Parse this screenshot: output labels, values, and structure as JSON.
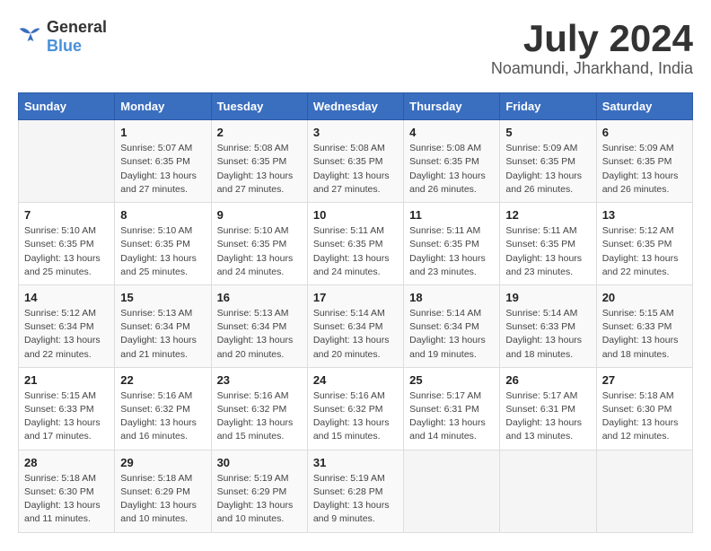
{
  "logo": {
    "text_general": "General",
    "text_blue": "Blue"
  },
  "title": {
    "month_year": "July 2024",
    "location": "Noamundi, Jharkhand, India"
  },
  "calendar": {
    "headers": [
      "Sunday",
      "Monday",
      "Tuesday",
      "Wednesday",
      "Thursday",
      "Friday",
      "Saturday"
    ],
    "weeks": [
      [
        {
          "day": "",
          "info": ""
        },
        {
          "day": "1",
          "info": "Sunrise: 5:07 AM\nSunset: 6:35 PM\nDaylight: 13 hours\nand 27 minutes."
        },
        {
          "day": "2",
          "info": "Sunrise: 5:08 AM\nSunset: 6:35 PM\nDaylight: 13 hours\nand 27 minutes."
        },
        {
          "day": "3",
          "info": "Sunrise: 5:08 AM\nSunset: 6:35 PM\nDaylight: 13 hours\nand 27 minutes."
        },
        {
          "day": "4",
          "info": "Sunrise: 5:08 AM\nSunset: 6:35 PM\nDaylight: 13 hours\nand 26 minutes."
        },
        {
          "day": "5",
          "info": "Sunrise: 5:09 AM\nSunset: 6:35 PM\nDaylight: 13 hours\nand 26 minutes."
        },
        {
          "day": "6",
          "info": "Sunrise: 5:09 AM\nSunset: 6:35 PM\nDaylight: 13 hours\nand 26 minutes."
        }
      ],
      [
        {
          "day": "7",
          "info": "Sunrise: 5:10 AM\nSunset: 6:35 PM\nDaylight: 13 hours\nand 25 minutes."
        },
        {
          "day": "8",
          "info": "Sunrise: 5:10 AM\nSunset: 6:35 PM\nDaylight: 13 hours\nand 25 minutes."
        },
        {
          "day": "9",
          "info": "Sunrise: 5:10 AM\nSunset: 6:35 PM\nDaylight: 13 hours\nand 24 minutes."
        },
        {
          "day": "10",
          "info": "Sunrise: 5:11 AM\nSunset: 6:35 PM\nDaylight: 13 hours\nand 24 minutes."
        },
        {
          "day": "11",
          "info": "Sunrise: 5:11 AM\nSunset: 6:35 PM\nDaylight: 13 hours\nand 23 minutes."
        },
        {
          "day": "12",
          "info": "Sunrise: 5:11 AM\nSunset: 6:35 PM\nDaylight: 13 hours\nand 23 minutes."
        },
        {
          "day": "13",
          "info": "Sunrise: 5:12 AM\nSunset: 6:35 PM\nDaylight: 13 hours\nand 22 minutes."
        }
      ],
      [
        {
          "day": "14",
          "info": "Sunrise: 5:12 AM\nSunset: 6:34 PM\nDaylight: 13 hours\nand 22 minutes."
        },
        {
          "day": "15",
          "info": "Sunrise: 5:13 AM\nSunset: 6:34 PM\nDaylight: 13 hours\nand 21 minutes."
        },
        {
          "day": "16",
          "info": "Sunrise: 5:13 AM\nSunset: 6:34 PM\nDaylight: 13 hours\nand 20 minutes."
        },
        {
          "day": "17",
          "info": "Sunrise: 5:14 AM\nSunset: 6:34 PM\nDaylight: 13 hours\nand 20 minutes."
        },
        {
          "day": "18",
          "info": "Sunrise: 5:14 AM\nSunset: 6:34 PM\nDaylight: 13 hours\nand 19 minutes."
        },
        {
          "day": "19",
          "info": "Sunrise: 5:14 AM\nSunset: 6:33 PM\nDaylight: 13 hours\nand 18 minutes."
        },
        {
          "day": "20",
          "info": "Sunrise: 5:15 AM\nSunset: 6:33 PM\nDaylight: 13 hours\nand 18 minutes."
        }
      ],
      [
        {
          "day": "21",
          "info": "Sunrise: 5:15 AM\nSunset: 6:33 PM\nDaylight: 13 hours\nand 17 minutes."
        },
        {
          "day": "22",
          "info": "Sunrise: 5:16 AM\nSunset: 6:32 PM\nDaylight: 13 hours\nand 16 minutes."
        },
        {
          "day": "23",
          "info": "Sunrise: 5:16 AM\nSunset: 6:32 PM\nDaylight: 13 hours\nand 15 minutes."
        },
        {
          "day": "24",
          "info": "Sunrise: 5:16 AM\nSunset: 6:32 PM\nDaylight: 13 hours\nand 15 minutes."
        },
        {
          "day": "25",
          "info": "Sunrise: 5:17 AM\nSunset: 6:31 PM\nDaylight: 13 hours\nand 14 minutes."
        },
        {
          "day": "26",
          "info": "Sunrise: 5:17 AM\nSunset: 6:31 PM\nDaylight: 13 hours\nand 13 minutes."
        },
        {
          "day": "27",
          "info": "Sunrise: 5:18 AM\nSunset: 6:30 PM\nDaylight: 13 hours\nand 12 minutes."
        }
      ],
      [
        {
          "day": "28",
          "info": "Sunrise: 5:18 AM\nSunset: 6:30 PM\nDaylight: 13 hours\nand 11 minutes."
        },
        {
          "day": "29",
          "info": "Sunrise: 5:18 AM\nSunset: 6:29 PM\nDaylight: 13 hours\nand 10 minutes."
        },
        {
          "day": "30",
          "info": "Sunrise: 5:19 AM\nSunset: 6:29 PM\nDaylight: 13 hours\nand 10 minutes."
        },
        {
          "day": "31",
          "info": "Sunrise: 5:19 AM\nSunset: 6:28 PM\nDaylight: 13 hours\nand 9 minutes."
        },
        {
          "day": "",
          "info": ""
        },
        {
          "day": "",
          "info": ""
        },
        {
          "day": "",
          "info": ""
        }
      ]
    ]
  }
}
